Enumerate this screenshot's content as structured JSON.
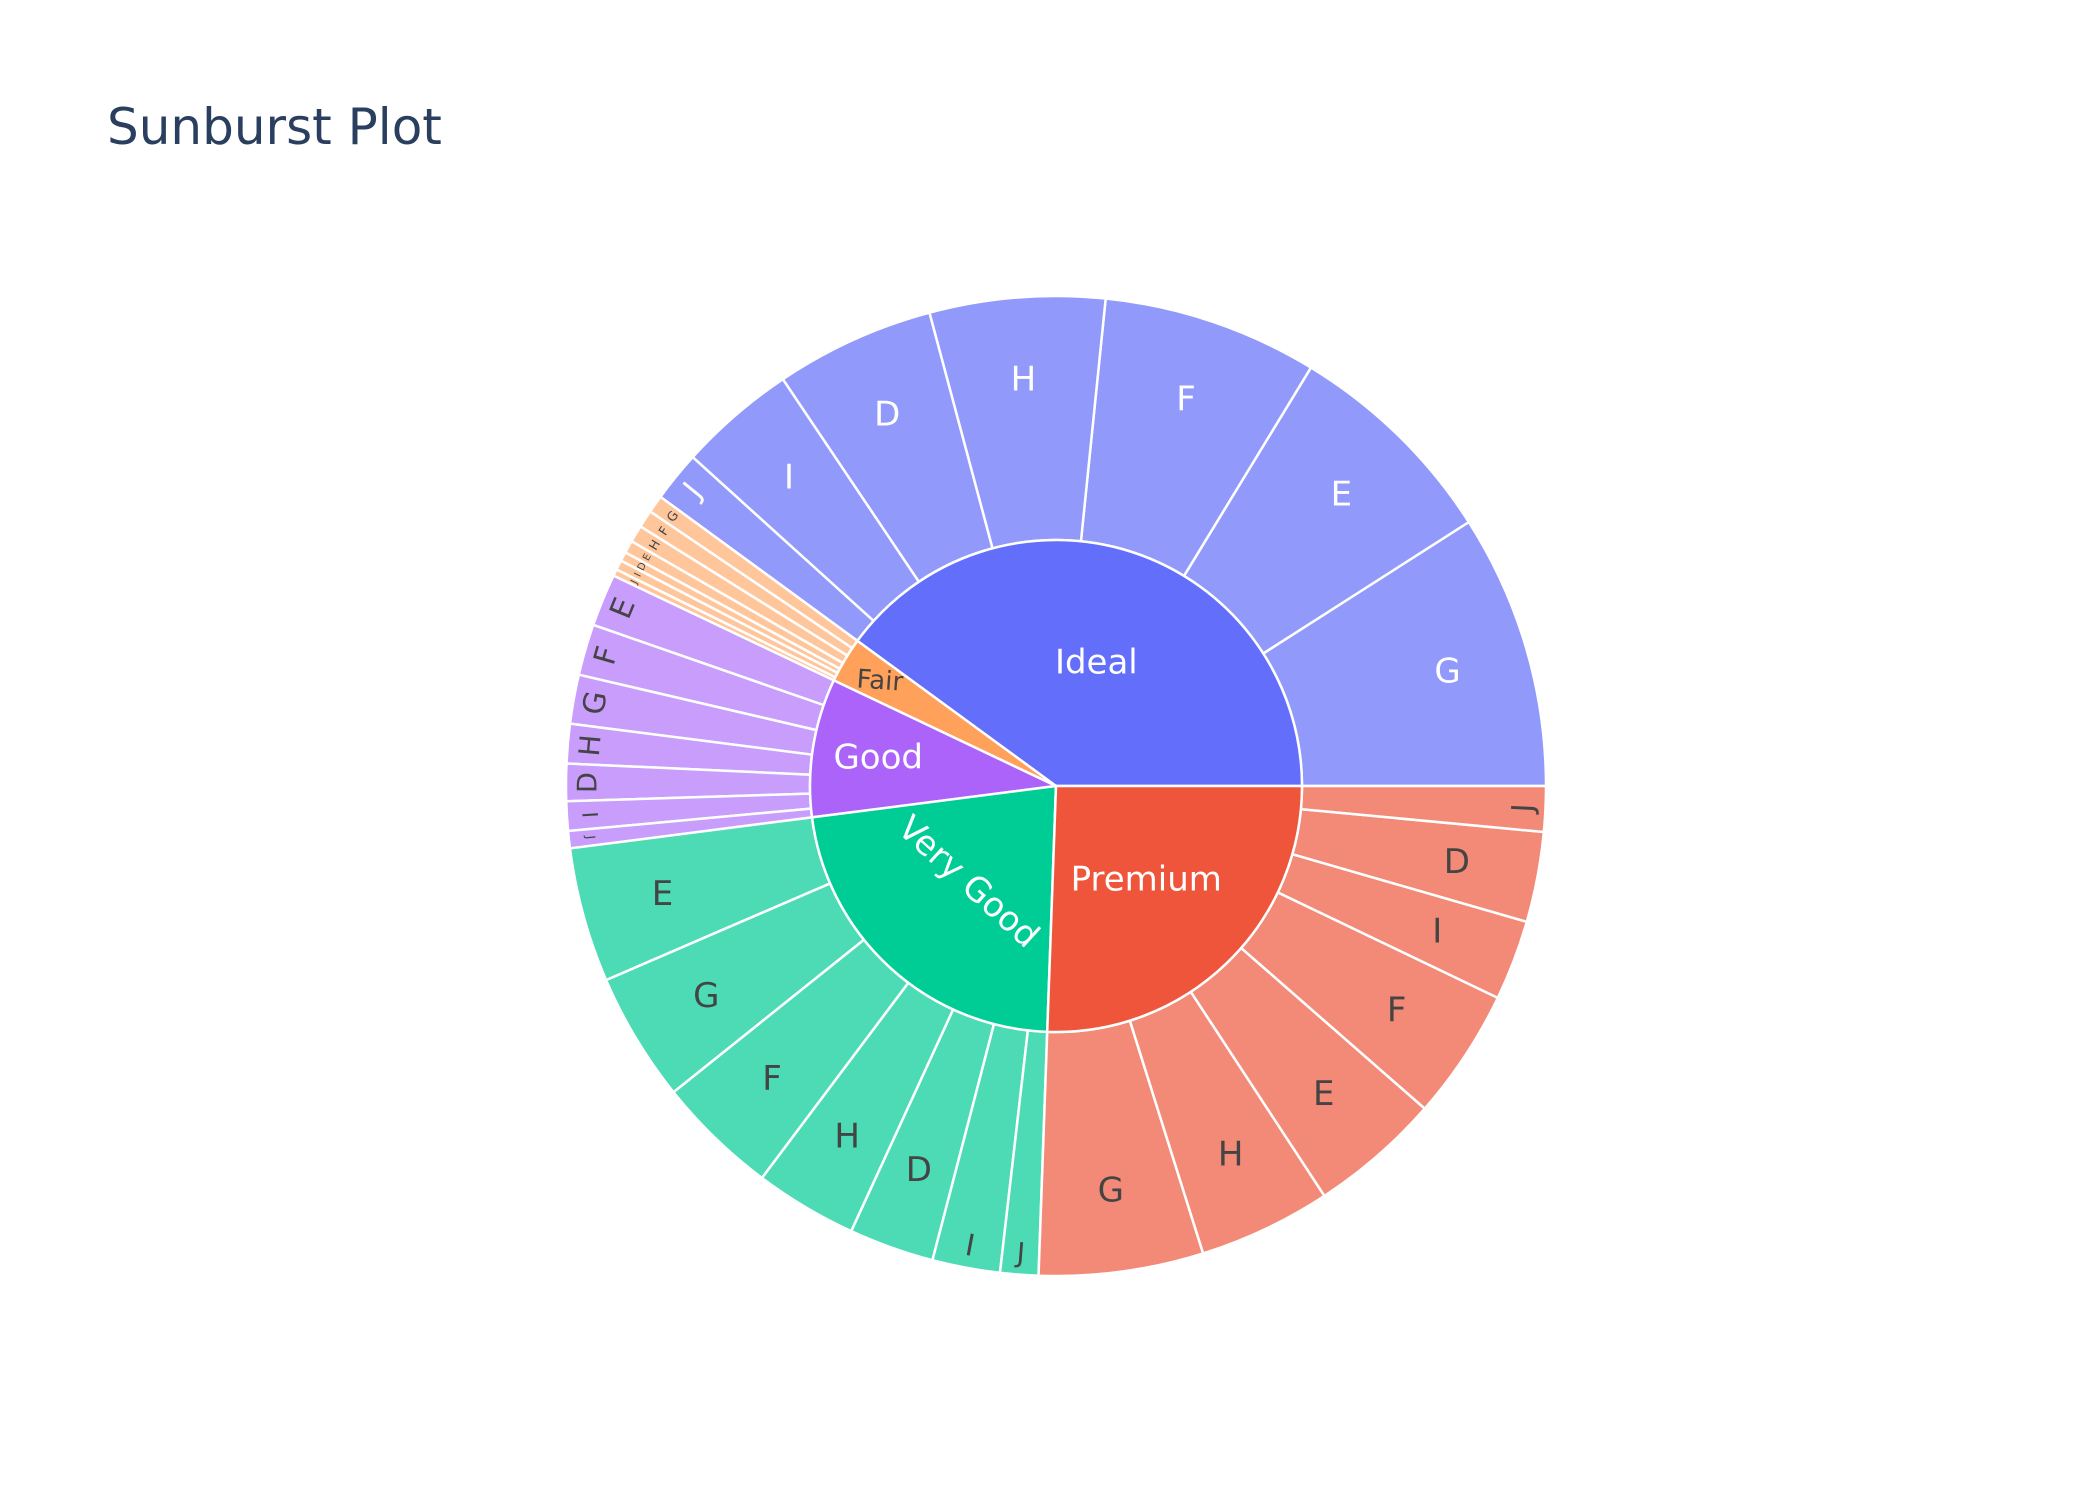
{
  "chart_data": {
    "type": "sunburst",
    "title": "Sunburst Plot",
    "value_unit": "count",
    "total": 53940,
    "groups": [
      {
        "name": "Ideal",
        "color": "#636efa",
        "child_color": "#9199fb",
        "children": [
          {
            "name": "G",
            "value": 4884
          },
          {
            "name": "E",
            "value": 3903
          },
          {
            "name": "F",
            "value": 3826
          },
          {
            "name": "H",
            "value": 3115
          },
          {
            "name": "D",
            "value": 2834
          },
          {
            "name": "I",
            "value": 2093
          },
          {
            "name": "J",
            "value": 896
          }
        ]
      },
      {
        "name": "Fair",
        "color": "#ffa15a",
        "child_color": "#ffc69c",
        "children": [
          {
            "name": "G",
            "value": 314
          },
          {
            "name": "F",
            "value": 312
          },
          {
            "name": "H",
            "value": 303
          },
          {
            "name": "E",
            "value": 224
          },
          {
            "name": "D",
            "value": 163
          },
          {
            "name": "I",
            "value": 175
          },
          {
            "name": "J",
            "value": 119
          }
        ]
      },
      {
        "name": "Good",
        "color": "#ab63fa",
        "child_color": "#c89dfc",
        "children": [
          {
            "name": "E",
            "value": 933
          },
          {
            "name": "F",
            "value": 909
          },
          {
            "name": "G",
            "value": 871
          },
          {
            "name": "H",
            "value": 702
          },
          {
            "name": "D",
            "value": 662
          },
          {
            "name": "I",
            "value": 522
          },
          {
            "name": "J",
            "value": 307
          }
        ]
      },
      {
        "name": "Very Good",
        "color": "#00cc96",
        "child_color": "#4ddbb6",
        "children": [
          {
            "name": "E",
            "value": 2400
          },
          {
            "name": "G",
            "value": 2299
          },
          {
            "name": "F",
            "value": 2164
          },
          {
            "name": "H",
            "value": 1824
          },
          {
            "name": "D",
            "value": 1513
          },
          {
            "name": "I",
            "value": 1204
          },
          {
            "name": "J",
            "value": 678
          }
        ]
      },
      {
        "name": "Premium",
        "color": "#ef553b",
        "child_color": "#f38a78",
        "children": [
          {
            "name": "G",
            "value": 2924
          },
          {
            "name": "H",
            "value": 2360
          },
          {
            "name": "E",
            "value": 2337
          },
          {
            "name": "F",
            "value": 2331
          },
          {
            "name": "I",
            "value": 1428
          },
          {
            "name": "D",
            "value": 1603
          },
          {
            "name": "J",
            "value": 808
          }
        ]
      }
    ]
  }
}
